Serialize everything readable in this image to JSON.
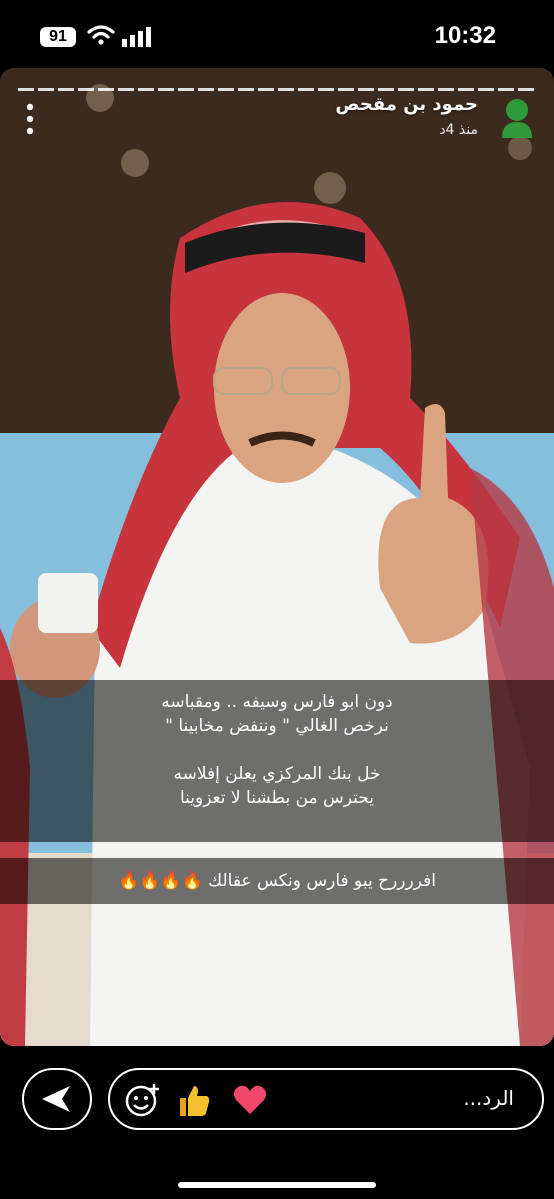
{
  "status": {
    "battery": "91",
    "time": "10:32"
  },
  "story": {
    "author": "حمود بن مقحص",
    "time_ago": "منذ 4د",
    "caption_lines": [
      "دون ابو فارس وسيفه .. ومقباسه",
      "نرخص الغالي \" وننفض مخابينا \"",
      "",
      "خل بنك المركزي يعلن إفلاسه",
      "يحترس من بطشنا لا تعزوينا"
    ],
    "caption2": "افررررح يبو فارس ونكس عقالك 🔥🔥🔥🔥"
  },
  "reply": {
    "placeholder": "الرد..."
  },
  "icons": {
    "send": "send-icon",
    "add_emoji": "add-emoji-icon",
    "thumbs_up": "thumbs-up-icon",
    "heart": "heart-icon",
    "more": "more-options-icon",
    "avatar": "avatar-icon"
  }
}
